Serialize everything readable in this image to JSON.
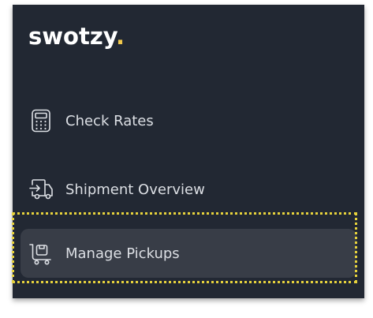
{
  "brand": {
    "name": "swotzy",
    "dot": ".",
    "accent_color": "#f2c94c"
  },
  "nav": {
    "items": [
      {
        "label": "Check Rates",
        "icon": "calculator-icon"
      },
      {
        "label": "Shipment Overview",
        "icon": "delivery-truck-icon"
      },
      {
        "label": "Manage Pickups",
        "icon": "pickup-cart-icon",
        "active": true
      }
    ]
  },
  "colors": {
    "sidebar_bg": "#222833",
    "active_item_bg": "#383d47",
    "text": "#dcdfe4",
    "highlight_border": "#e6d23c"
  }
}
